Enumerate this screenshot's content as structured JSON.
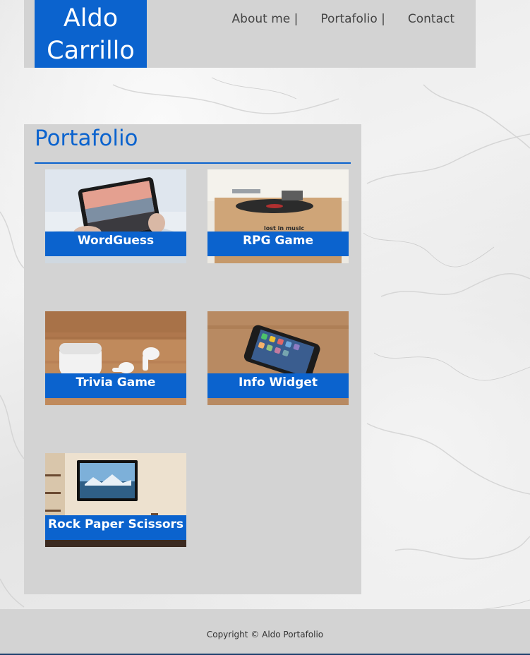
{
  "header": {
    "brand_line1": "Aldo",
    "brand_line2": "Carrillo",
    "nav": [
      {
        "label": "About me |"
      },
      {
        "label": "Portafolio |"
      },
      {
        "label": "Contact"
      }
    ]
  },
  "portfolio": {
    "title": "Portafolio",
    "projects": [
      {
        "label": "WordGuess",
        "image": "tablet-photo"
      },
      {
        "label": "RPG Game",
        "image": "turntable-photo"
      },
      {
        "label": "Trivia Game",
        "image": "earbuds-photo"
      },
      {
        "label": "Info Widget",
        "image": "smartphone-photo"
      },
      {
        "label": "Rock Paper Scissors",
        "image": "tv-photo"
      }
    ]
  },
  "footer": {
    "copyright": "Copyright © Aldo Portafolio"
  },
  "colors": {
    "accent": "#0b63ce",
    "panel": "#d3d3d3",
    "text": "#444444"
  }
}
